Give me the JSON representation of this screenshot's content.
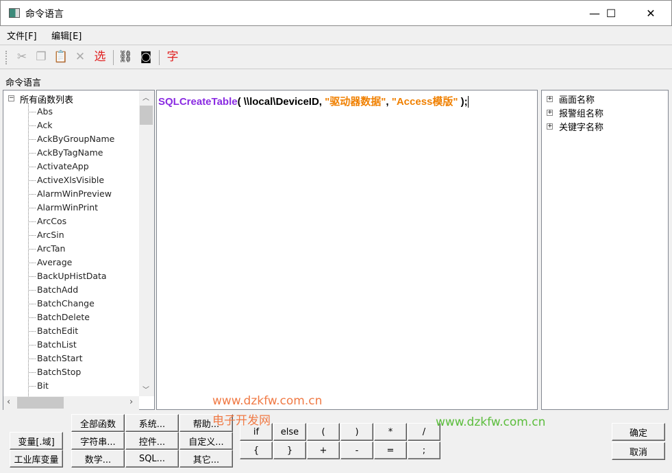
{
  "window": {
    "title": "命令语言",
    "minimize": "—",
    "maximize": "☐",
    "close": "✕"
  },
  "menu": [
    "文件[F]",
    "编辑[E]"
  ],
  "toolbar": {
    "select": "选",
    "font": "字"
  },
  "section_label": "命令语言",
  "left_tree": {
    "root": "所有函数列表",
    "items": [
      "Abs",
      "Ack",
      "AckByGroupName",
      "AckByTagName",
      "ActivateApp",
      "ActiveXlsVisible",
      "AlarmWinPreview",
      "AlarmWinPrint",
      "ArcCos",
      "ArcSin",
      "ArcTan",
      "Average",
      "BackUpHistData",
      "BatchAdd",
      "BatchChange",
      "BatchDelete",
      "BatchEdit",
      "BatchList",
      "BatchStart",
      "BatchStop",
      "Bit"
    ]
  },
  "editor": {
    "func": "SQLCreateTable",
    "open": "( \\\\local\\DeviceID, ",
    "arg1": "\"驱动器数据\"",
    "comma": ", ",
    "arg2": "\"Access模版\"",
    "close": " );"
  },
  "right_tree": [
    "画面名称",
    "报警组名称",
    "关键字名称"
  ],
  "buttons": {
    "var_domain": "变量[.域]",
    "db_var": "工业库变量",
    "all_funcs": "全部函数",
    "system": "系统...",
    "help": "帮助...",
    "string": "字符串...",
    "control": "控件...",
    "custom": "自定义...",
    "math": "数学...",
    "sql": "SQL...",
    "other": "其它...",
    "ok": "确定",
    "cancel": "取消"
  },
  "operators": [
    "if",
    "else",
    "(",
    ")",
    "*",
    "/",
    "{",
    "}",
    "+",
    "-",
    "=",
    ";"
  ],
  "watermarks": {
    "url1": "www.dzkfw.com.cn",
    "name": "电子开发网",
    "url2": "www.dzkfw.com.cn"
  },
  "colors": {
    "func": "#8a2be2",
    "string": "#f08000"
  }
}
